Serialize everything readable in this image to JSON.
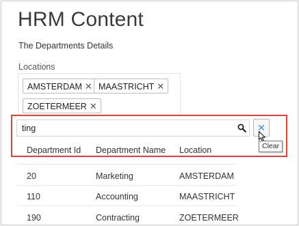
{
  "page": {
    "title": "HRM Content",
    "subtitle": "The Departments Details"
  },
  "locations": {
    "label": "Locations",
    "chips": [
      {
        "label": "AMSTERDAM",
        "remove_glyph": "✕"
      },
      {
        "label": "MAASTRICHT",
        "remove_glyph": "✕"
      },
      {
        "label": "ZOETERMEER",
        "remove_glyph": "✕"
      }
    ]
  },
  "search": {
    "value": "ting",
    "icon": "search-icon",
    "clear_glyph": "✕",
    "clear_tooltip": "Clear"
  },
  "table": {
    "columns": [
      "Department Id",
      "Department Name",
      "Location"
    ],
    "rows": [
      [
        "20",
        "Marketing",
        "AMSTERDAM"
      ],
      [
        "110",
        "Accounting",
        "MAASTRICHT"
      ],
      [
        "190",
        "Contracting",
        "ZOETERMEER"
      ]
    ]
  },
  "colors": {
    "highlight": "#e0403a",
    "clear_accent": "#3a8dd6"
  }
}
